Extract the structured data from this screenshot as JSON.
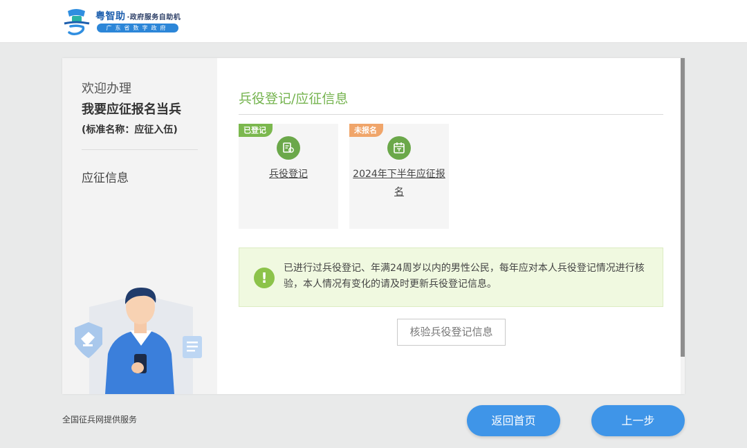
{
  "header": {
    "logo_title": "粤智助",
    "logo_subtitle": "·政府服务自助机",
    "logo_tagline": "广东省数字政府"
  },
  "sidebar": {
    "welcome": "欢迎办理",
    "service_name": "我要应征报名当兵",
    "standard_name": "(标准名称：应征入伍)",
    "nav_item": "应征信息"
  },
  "main": {
    "section_title": "兵役登记/应征信息",
    "tiles": [
      {
        "tag": "已登记",
        "tag_color": "#7bb84e",
        "label": "兵役登记",
        "icon": "register-icon"
      },
      {
        "tag": "未报名",
        "tag_color": "#f0a56a",
        "label": "2024年下半年应征报名",
        "icon": "calendar-icon"
      }
    ],
    "notice": "已进行过兵役登记、年满24周岁以内的男性公民，每年应对本人兵役登记情况进行核验，本人情况有变化的请及时更新兵役登记信息。",
    "verify_button": "核验兵役登记信息"
  },
  "footer": {
    "provider": "全国征兵网提供服务",
    "home_button": "返回首页",
    "prev_button": "上一步"
  },
  "colors": {
    "accent_green": "#74b34e",
    "button_blue": "#3f95e8",
    "brand_blue": "#1d5fae"
  }
}
